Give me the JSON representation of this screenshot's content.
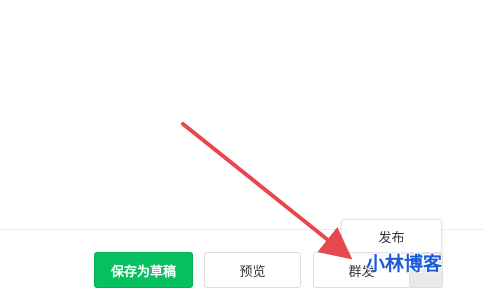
{
  "footer": {
    "save_draft_label": "保存为草稿",
    "preview_label": "预览",
    "mass_send_label": "群发"
  },
  "publish_menu": {
    "items": [
      "发布"
    ]
  },
  "watermark": {
    "text": "小林博客"
  },
  "colors": {
    "primary_green": "#07c160",
    "arrow_red": "#e5484d",
    "watermark_blue": "#1c5bd8"
  }
}
